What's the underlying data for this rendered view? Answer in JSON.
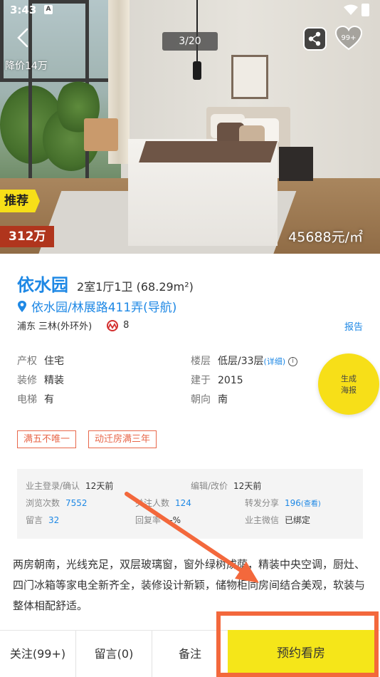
{
  "status_bar": {
    "time": "3:43",
    "notification_glyph": "A"
  },
  "hero": {
    "price_drop": "降价14万",
    "photo_counter": "3/20",
    "favorite_count": "99+",
    "recommend_tag": "推荐",
    "total_price": "312万",
    "unit_price": "45688元/㎡"
  },
  "listing": {
    "name": "依水园",
    "layout": "2室1厅1卫 (68.29m²)",
    "address": "依水园/林展路411弄(导航)",
    "district": "浦东",
    "area": "三林(外环外)",
    "metro_line": "8",
    "report_label": "报告"
  },
  "attributes": {
    "ownership": {
      "label": "产权",
      "value": "住宅"
    },
    "decoration": {
      "label": "装修",
      "value": "精装"
    },
    "elevator": {
      "label": "电梯",
      "value": "有"
    },
    "floor": {
      "label": "楼层",
      "value": "低层/33层",
      "detail": "(详细)"
    },
    "built": {
      "label": "建于",
      "value": "2015"
    },
    "orientation": {
      "label": "朝向",
      "value": "南"
    }
  },
  "poster_button": {
    "line1": "生成",
    "line2": "海报"
  },
  "tags": [
    "满五不唯一",
    "动迁房满三年"
  ],
  "stats": {
    "owner_login": {
      "label": "业主登录/确认",
      "value": "12天前"
    },
    "edit_price": {
      "label": "编辑/改价",
      "value": "12天前"
    },
    "views": {
      "label": "浏览次数",
      "value": "7552"
    },
    "followers": {
      "label": "关注人数",
      "value": "124"
    },
    "shares": {
      "label": "转发分享",
      "value": "196",
      "sub": "(查看)"
    },
    "messages": {
      "label": "留言",
      "value": "32"
    },
    "reply_rate": {
      "label": "回复率",
      "value": "--%"
    },
    "owner_wechat": {
      "label": "业主微信",
      "value": "已绑定"
    }
  },
  "description": "两房朝南，光线充足，双层玻璃窗，窗外绿树成荫，精装中央空调，厨灶、四门冰箱等家电全新齐全，装修设计新颖，储物柜同房间结合美观，软装与整体相配舒适。",
  "bottom_bar": {
    "follow": "关注(99+)",
    "message": "留言(0)",
    "note": "备注",
    "book": "预约看房"
  },
  "colors": {
    "accent_blue": "#1e88e5",
    "brand_yellow": "#f5e619",
    "price_red": "#b0351d",
    "tag_orange": "#e8674a",
    "annotation_orange": "#f3683c"
  }
}
